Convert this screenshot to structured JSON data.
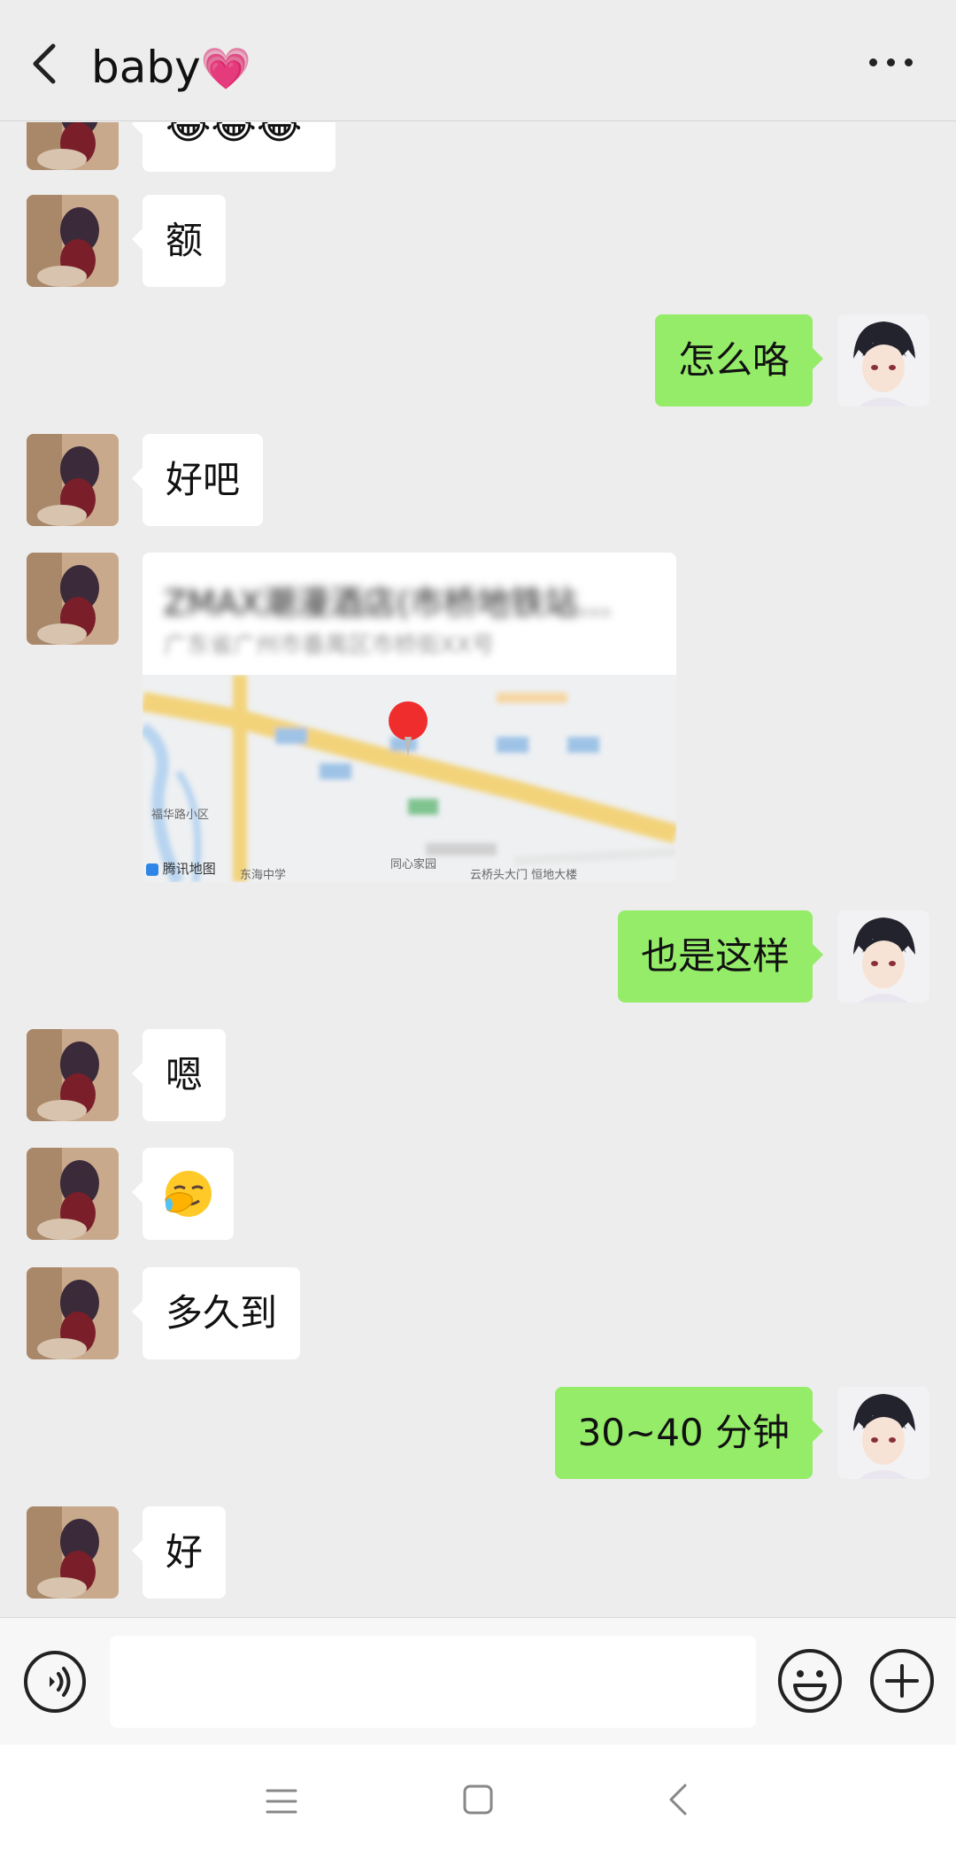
{
  "header": {
    "title": "baby",
    "title_emoji": "💗",
    "back_icon": "chevron-left-icon",
    "more_icon": "more-dots-icon"
  },
  "messages": [
    {
      "side": "in",
      "type": "emoji",
      "text": "😂😂😂"
    },
    {
      "side": "in",
      "type": "text",
      "text": "额"
    },
    {
      "side": "out",
      "type": "text",
      "text": "怎么咯"
    },
    {
      "side": "in",
      "type": "text",
      "text": "好吧"
    },
    {
      "side": "in",
      "type": "location",
      "title": "ZMAX潮漫酒店(市桥地铁站…",
      "address": "广东省广州市番禺区市桥街XX号",
      "map_attribution": "腾讯地图"
    },
    {
      "side": "out",
      "type": "text",
      "text": "也是这样"
    },
    {
      "side": "in",
      "type": "text",
      "text": "嗯"
    },
    {
      "side": "in",
      "type": "emoji",
      "text": "🤦"
    },
    {
      "side": "in",
      "type": "text",
      "text": "多久到"
    },
    {
      "side": "out",
      "type": "text",
      "text": "30~40 分钟"
    },
    {
      "side": "in",
      "type": "text",
      "text": "好"
    }
  ],
  "input_bar": {
    "voice_icon": "voice-icon",
    "placeholder": "",
    "emoji_icon": "smiley-icon",
    "plus_icon": "plus-circle-icon"
  },
  "navbar": {
    "menu_icon": "menu-icon",
    "home_icon": "home-square-icon",
    "back_icon": "back-triangle-icon"
  },
  "colors": {
    "background": "#ededed",
    "incoming_bubble": "#ffffff",
    "outgoing_bubble": "#95ec69"
  }
}
